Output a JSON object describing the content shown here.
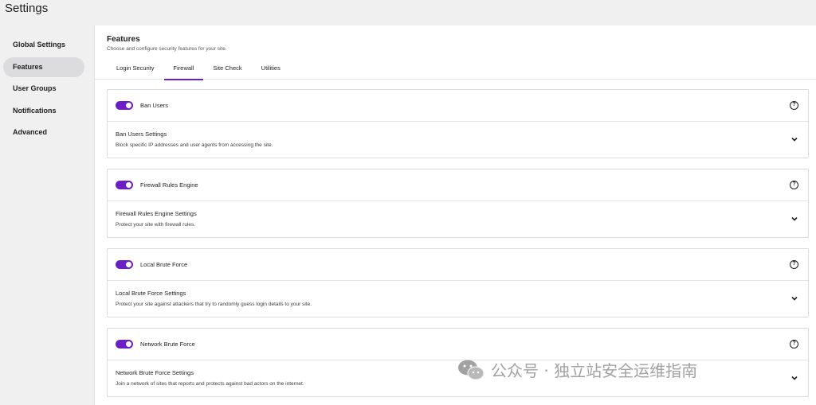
{
  "app": {
    "title": "Settings"
  },
  "sidebar": {
    "items": [
      {
        "label": "Global Settings",
        "active": false
      },
      {
        "label": "Features",
        "active": true
      },
      {
        "label": "User Groups",
        "active": false
      },
      {
        "label": "Notifications",
        "active": false
      },
      {
        "label": "Advanced",
        "active": false
      }
    ]
  },
  "main": {
    "title": "Features",
    "description": "Choose and configure security features for your site.",
    "tabs": [
      {
        "label": "Login Security",
        "active": false
      },
      {
        "label": "Firewall",
        "active": true
      },
      {
        "label": "Site Check",
        "active": false
      },
      {
        "label": "Utilities",
        "active": false
      }
    ],
    "cards": [
      {
        "name": "Ban Users",
        "enabled": true,
        "settings_title": "Ban Users Settings",
        "settings_desc": "Block specific IP addresses and user agents from accessing the site."
      },
      {
        "name": "Firewall Rules Engine",
        "enabled": true,
        "settings_title": "Firewall Rules Engine Settings",
        "settings_desc": "Protect your site with firewall rules."
      },
      {
        "name": "Local Brute Force",
        "enabled": true,
        "settings_title": "Local Brute Force Settings",
        "settings_desc": "Protect your site against attackers that try to randomly guess login details to your site."
      },
      {
        "name": "Network Brute Force",
        "enabled": true,
        "settings_title": "Network Brute Force Settings",
        "settings_desc": "Join a network of sites that reports and protects against bad actors on the internet."
      }
    ]
  },
  "watermark": {
    "text": "公众号 · 独立站安全运维指南"
  },
  "colors": {
    "accent": "#6b1ec6",
    "background": "#f0f0f1",
    "panel": "#ffffff"
  },
  "icons": {
    "help": "help-circle-icon",
    "chevron": "chevron-down-icon",
    "watermark": "wechat-icon"
  }
}
